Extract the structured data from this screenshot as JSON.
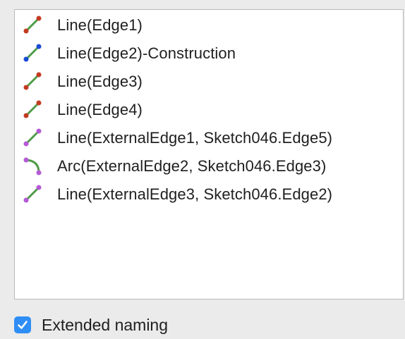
{
  "constraints_list": {
    "items": [
      {
        "label": "Line(Edge1)",
        "icon": "line-edge-icon",
        "color_start": "#c23b22",
        "color_end": "#c23b22",
        "color_line": "#4f9b48"
      },
      {
        "label": "Line(Edge2)-Construction",
        "icon": "line-construction-icon",
        "color_start": "#1a4bd6",
        "color_end": "#1a4bd6",
        "color_line": "#4f9b48"
      },
      {
        "label": "Line(Edge3)",
        "icon": "line-edge-icon",
        "color_start": "#c23b22",
        "color_end": "#c23b22",
        "color_line": "#4f9b48"
      },
      {
        "label": "Line(Edge4)",
        "icon": "line-edge-icon",
        "color_start": "#c23b22",
        "color_end": "#c23b22",
        "color_line": "#4f9b48"
      },
      {
        "label": "Line(ExternalEdge1, Sketch046.Edge5)",
        "icon": "line-external-icon",
        "color_start": "#b45ad6",
        "color_end": "#b45ad6",
        "color_line": "#4f9b48"
      },
      {
        "label": "Arc(ExternalEdge2, Sketch046.Edge3)",
        "icon": "arc-external-icon",
        "color_start": "#b45ad6",
        "color_end": "#b45ad6",
        "color_line": "#4f9b48"
      },
      {
        "label": "Line(ExternalEdge3, Sketch046.Edge2)",
        "icon": "line-external-icon",
        "color_start": "#b45ad6",
        "color_end": "#b45ad6",
        "color_line": "#4f9b48"
      }
    ]
  },
  "extended_naming": {
    "label": "Extended naming",
    "checked": true,
    "accent_color": "#2f8ef5"
  }
}
